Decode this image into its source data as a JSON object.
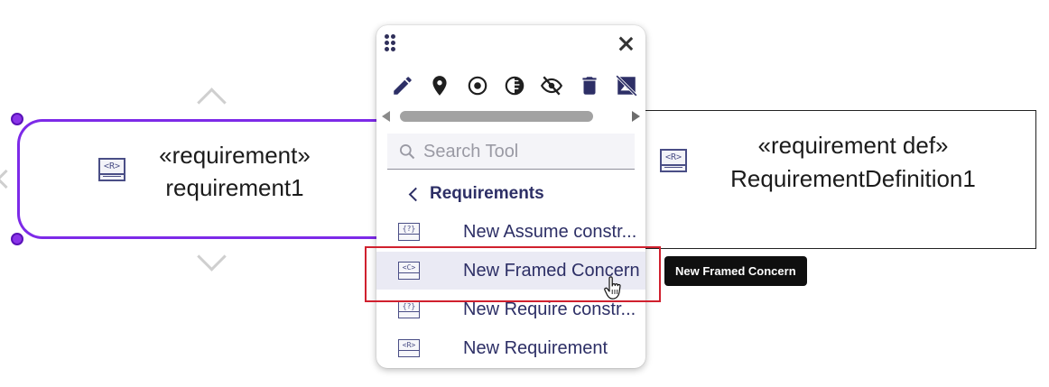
{
  "diagram": {
    "requirement_node": {
      "icon": "requirement-icon",
      "icon_text": "<R>",
      "stereotype": "«requirement»",
      "name": "requirement1"
    },
    "definition_node": {
      "icon": "requirement-icon",
      "icon_text": "<R>",
      "stereotype": "«requirement def»",
      "name": "RequirementDefinition1"
    }
  },
  "palette": {
    "toolbar": [
      {
        "icon": "pencil-icon",
        "name": "edit"
      },
      {
        "icon": "pin-icon",
        "name": "pin"
      },
      {
        "icon": "target-icon",
        "name": "pin-center"
      },
      {
        "icon": "contrast-icon",
        "name": "fade"
      },
      {
        "icon": "eye-off-icon",
        "name": "hide"
      },
      {
        "icon": "trash-icon",
        "name": "delete"
      },
      {
        "icon": "image-off-icon",
        "name": "hide-image"
      }
    ],
    "search": {
      "placeholder": "Search Tool",
      "value": ""
    },
    "group": {
      "label": "Requirements"
    },
    "items": [
      {
        "label": "New Assume constr...",
        "icon_text": "{?}",
        "icon": "assume-constraint-icon"
      },
      {
        "label": "New Framed Concern",
        "icon_text": "<C>",
        "icon": "concern-icon"
      },
      {
        "label": "New Require constr...",
        "icon_text": "{?}",
        "icon": "require-constraint-icon"
      },
      {
        "label": "New Requirement",
        "icon_text": "<R>",
        "icon": "requirement-icon"
      }
    ],
    "hovered_item_index": 1
  },
  "tooltip": {
    "text": "New Framed Concern"
  },
  "colors": {
    "selection": "#7d2ae8",
    "highlight": "#d0202e",
    "accent_text": "#2d2f66",
    "tooltip_bg": "#0f0f0f"
  }
}
